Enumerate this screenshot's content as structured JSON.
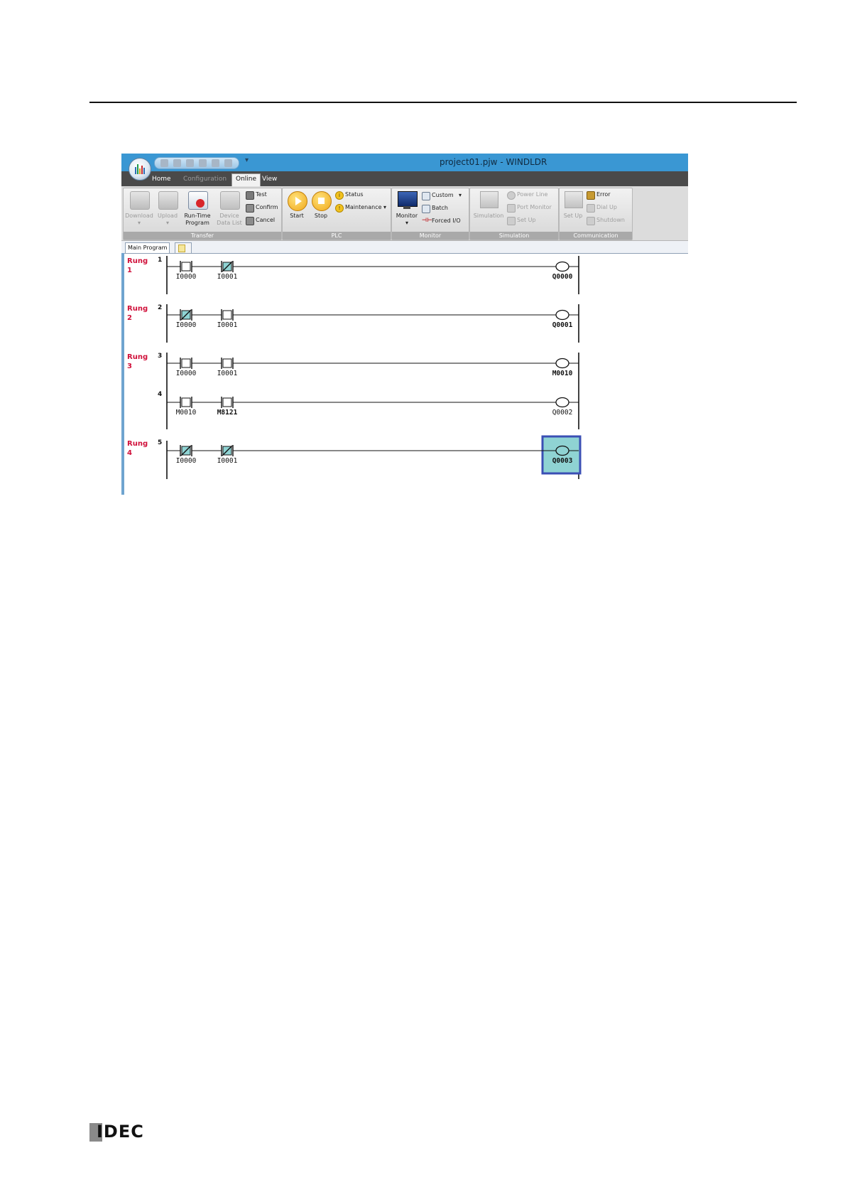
{
  "window": {
    "title": "project01.pjw - WINDLDR"
  },
  "ribbon_tabs": [
    {
      "label": "Home",
      "state": "normal"
    },
    {
      "label": "Configuration",
      "state": "disabled"
    },
    {
      "label": "Online",
      "state": "active"
    },
    {
      "label": "View",
      "state": "normal"
    }
  ],
  "groups": {
    "transfer": {
      "label": "Transfer",
      "download": "Download",
      "upload": "Upload",
      "runtime_line1": "Run-Time",
      "runtime_line2": "Program",
      "device_line1": "Device",
      "device_line2": "Data List",
      "test": "Test",
      "confirm": "Confirm",
      "cancel": "Cancel"
    },
    "plc": {
      "label": "PLC",
      "start": "Start",
      "stop": "Stop",
      "status": "Status",
      "maintenance": "Maintenance"
    },
    "monitor": {
      "label": "Monitor",
      "monitor": "Monitor",
      "custom": "Custom",
      "batch": "Batch",
      "forced": "Forced I/O"
    },
    "simulation": {
      "label": "Simulation",
      "simulation": "Simulation",
      "power_line": "Power Line",
      "port_monitor": "Port Monitor",
      "set_up": "Set Up"
    },
    "communication": {
      "label": "Communication",
      "set_up": "Set Up",
      "error": "Error",
      "dial_up": "Dial Up",
      "shutdown": "Shutdown"
    }
  },
  "doc_tab": "Main Program",
  "rung_labels": [
    {
      "word": "Rung",
      "num": "1"
    },
    {
      "word": "Rung",
      "num": "2"
    },
    {
      "word": "Rung",
      "num": "3"
    },
    {
      "word": "Rung",
      "num": "4"
    }
  ],
  "line_numbers": [
    "1",
    "2",
    "3",
    "4",
    "5"
  ],
  "ladder": [
    {
      "line": "1",
      "contacts": [
        {
          "op": "I0000",
          "type": "NO",
          "on": false
        },
        {
          "op": "I0001",
          "type": "NC",
          "on": true
        }
      ],
      "coil": {
        "op": "Q0000",
        "on": false,
        "selected": false
      }
    },
    {
      "line": "2",
      "contacts": [
        {
          "op": "I0000",
          "type": "NC",
          "on": true
        },
        {
          "op": "I0001",
          "type": "NO",
          "on": false
        }
      ],
      "coil": {
        "op": "Q0001",
        "on": false,
        "selected": false
      }
    },
    {
      "line": "3",
      "contacts": [
        {
          "op": "I0000",
          "type": "NO",
          "on": false
        },
        {
          "op": "I0001",
          "type": "NO",
          "on": false
        }
      ],
      "coil": {
        "op": "M0010",
        "on": false,
        "selected": false
      }
    },
    {
      "line": "4",
      "contacts": [
        {
          "op": "M0010",
          "type": "NO",
          "on": false
        },
        {
          "op": "M8121",
          "type": "NO",
          "on": false
        }
      ],
      "coil": {
        "op": "Q0002",
        "on": false,
        "selected": false
      }
    },
    {
      "line": "5",
      "contacts": [
        {
          "op": "I0000",
          "type": "NC",
          "on": true
        },
        {
          "op": "I0001",
          "type": "NC",
          "on": true
        }
      ],
      "coil": {
        "op": "Q0003",
        "on": true,
        "selected": true
      }
    }
  ],
  "colors": {
    "rung_label": "#d0103a",
    "energized": "#8fd3d3",
    "selection": "#3b4fb4"
  },
  "icons": {
    "start": "play-icon",
    "stop": "stop-icon",
    "status": "info-icon",
    "maintenance": "warning-icon"
  },
  "logo": {
    "text": "IDEC"
  }
}
